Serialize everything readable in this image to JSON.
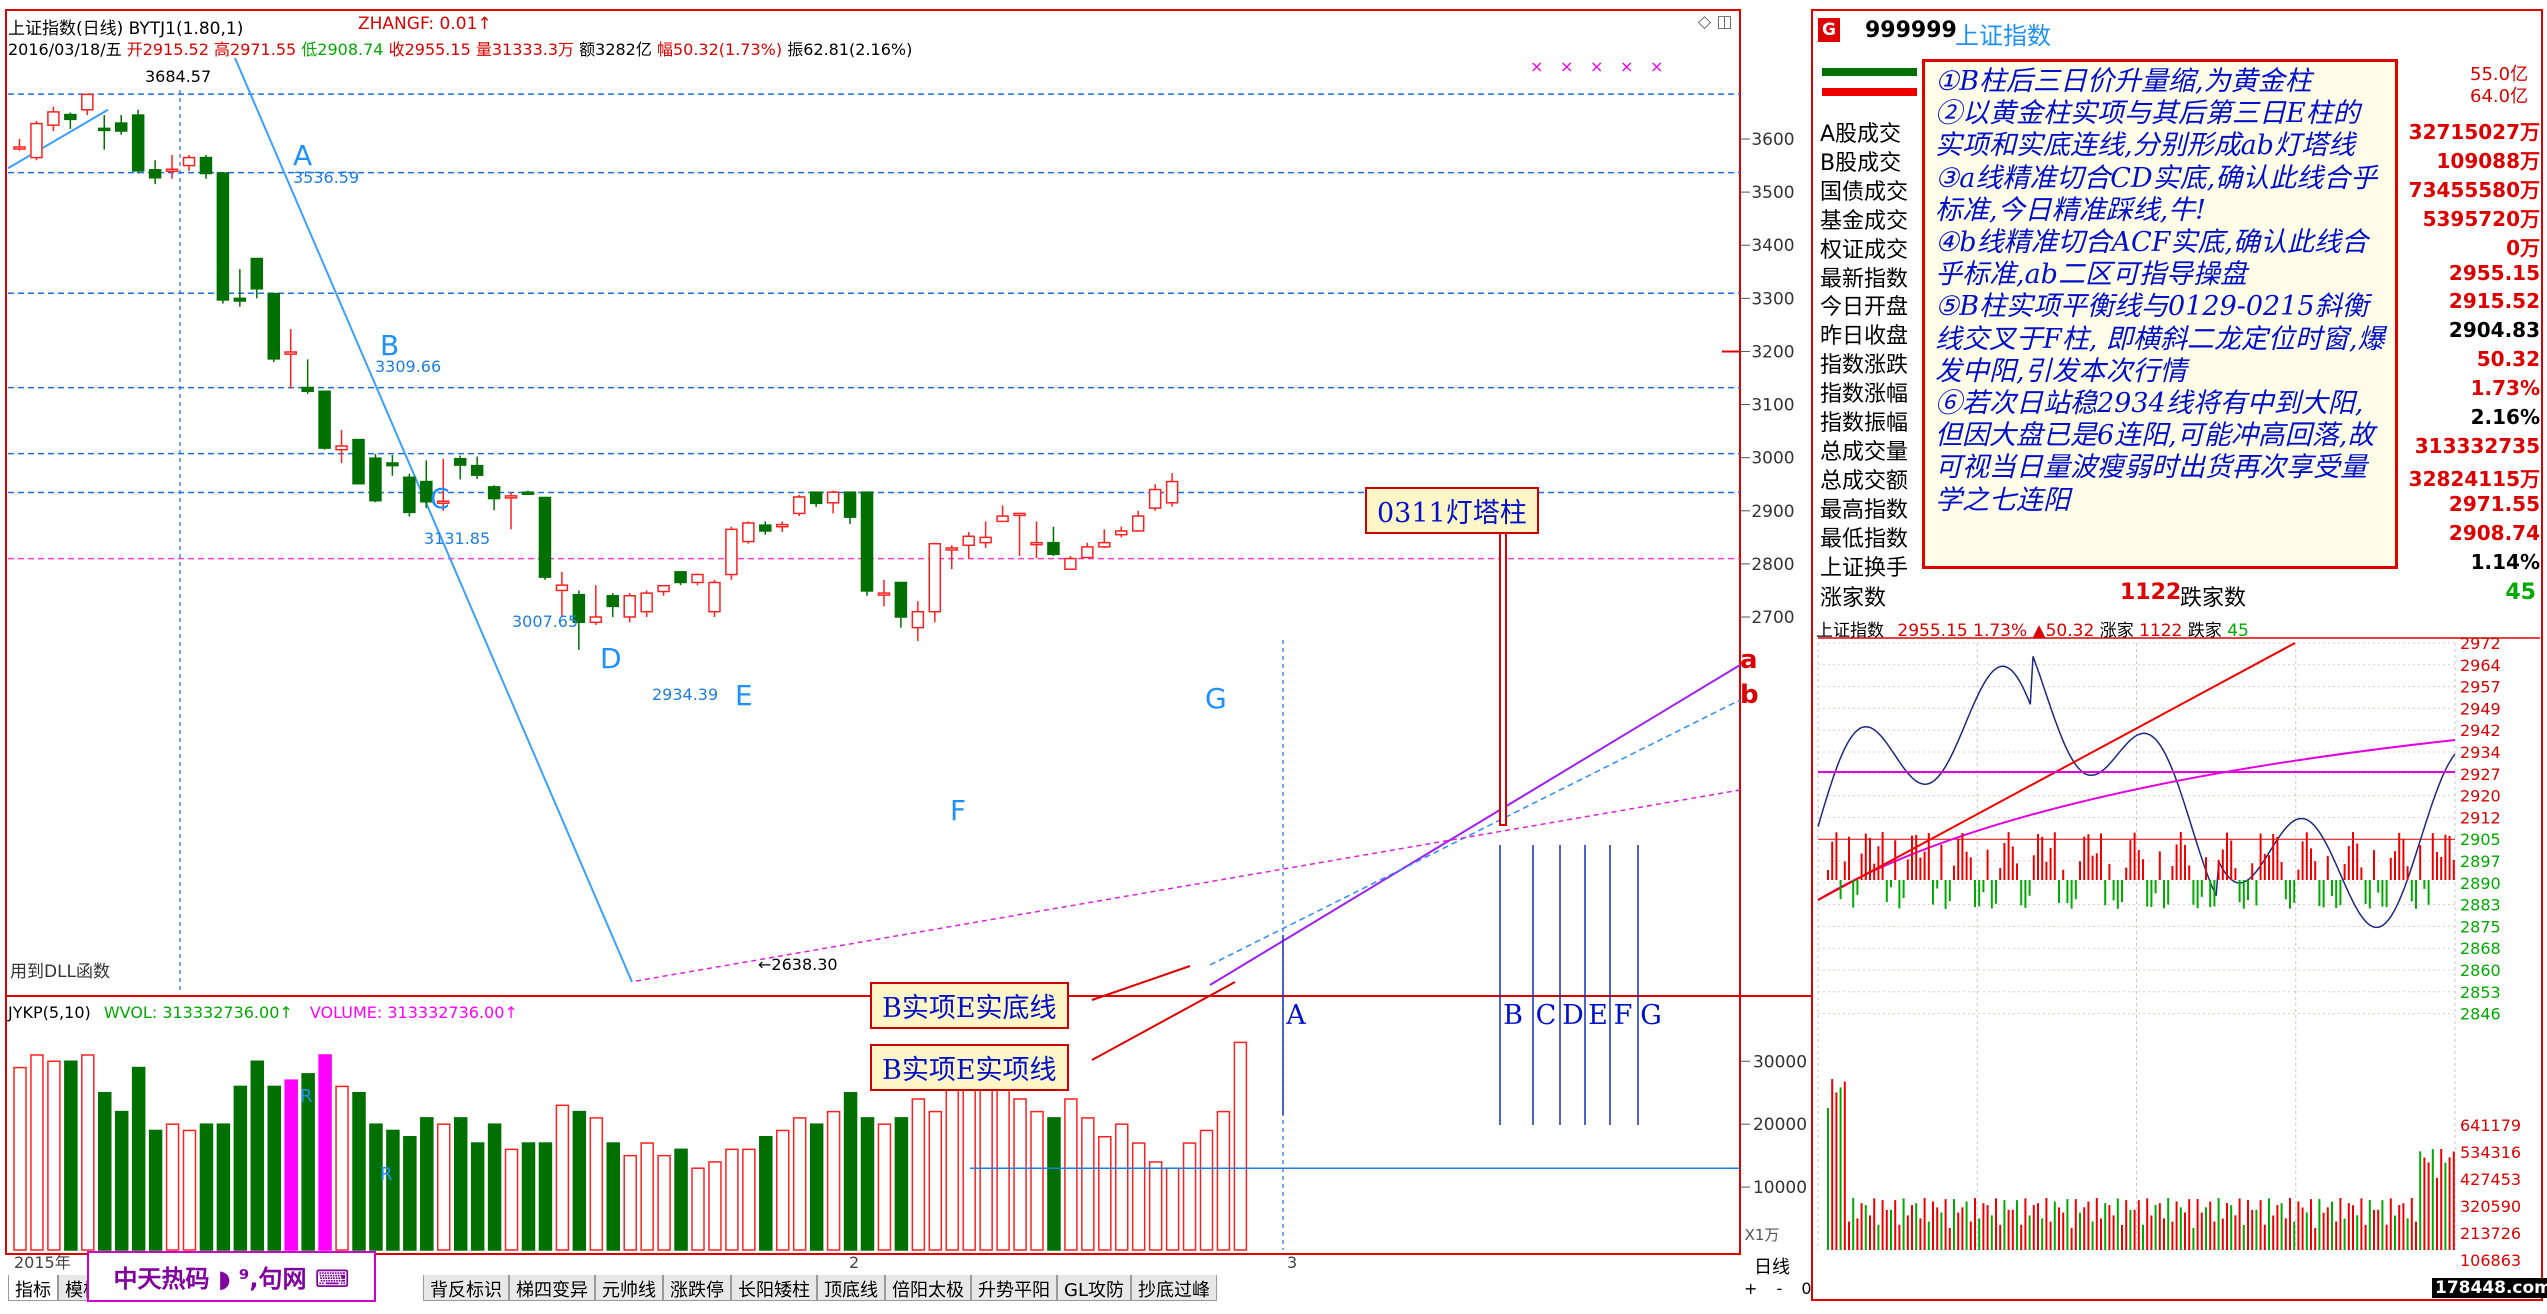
{
  "header": {
    "title": "上证指数(日线) BYTJ1(1.80,1)",
    "indicator": "ZHANGF: 0.01↑",
    "date": "2016/03/18/五",
    "open_label": "开",
    "open": "2915.52",
    "high_label": "高",
    "high": "2971.55",
    "low_label": "低",
    "low": "2908.74",
    "close_label": "收",
    "close": "2955.15",
    "vol_label": "量",
    "vol": "31333.3万",
    "amt_label": "额",
    "amt": "3282亿",
    "chg_label": "幅",
    "chg": "50.32(1.73%)",
    "amp_label": "振",
    "amp": "62.81(2.16%)"
  },
  "chart_data": {
    "type": "candlestick",
    "title": "上证指数(日线)",
    "ylim": [
      2600,
      3700
    ],
    "y_ticks": [
      2700,
      2800,
      2900,
      3000,
      3100,
      3200,
      3300,
      3400,
      3500,
      3600
    ],
    "candles": [
      [
        3582,
        3585,
        3600,
        3578
      ],
      [
        3565,
        3629,
        3634,
        3560
      ],
      [
        3626,
        3651,
        3661,
        3615
      ],
      [
        3646,
        3637,
        3650,
        3619
      ],
      [
        3655,
        3684,
        3685,
        3645
      ],
      [
        3620,
        3617,
        3645,
        3580
      ],
      [
        3630,
        3615,
        3645,
        3608
      ],
      [
        3645,
        3540,
        3655,
        3535
      ],
      [
        3542,
        3527,
        3560,
        3515
      ],
      [
        3540,
        3543,
        3570,
        3525
      ],
      [
        3550,
        3565,
        3570,
        3540
      ],
      [
        3565,
        3535,
        3570,
        3525
      ],
      [
        3536,
        3297,
        3536,
        3290
      ],
      [
        3300,
        3295,
        3355,
        3284
      ],
      [
        3375,
        3318,
        3375,
        3300
      ],
      [
        3309,
        3186,
        3309,
        3180
      ],
      [
        3195,
        3199,
        3242,
        3130
      ],
      [
        3132,
        3125,
        3185,
        3120
      ],
      [
        3125,
        3018,
        3125,
        3015
      ],
      [
        3015,
        3022,
        3052,
        2990
      ],
      [
        3034,
        2951,
        3035,
        2950
      ],
      [
        2999,
        2919,
        3007,
        2916
      ],
      [
        2990,
        2985,
        3005,
        2966
      ],
      [
        2963,
        2897,
        2970,
        2889
      ],
      [
        2955,
        2917,
        2995,
        2905
      ],
      [
        2917,
        2918,
        2998,
        2900
      ],
      [
        2998,
        2986,
        3004,
        2959
      ],
      [
        2985,
        2967,
        3002,
        2960
      ],
      [
        2945,
        2923,
        2948,
        2901
      ],
      [
        2925,
        2928,
        2934,
        2865
      ],
      [
        2935,
        2934,
        2938,
        2930
      ],
      [
        2925,
        2775,
        2925,
        2770
      ],
      [
        2750,
        2760,
        2785,
        2700
      ],
      [
        2742,
        2690,
        2750,
        2638
      ],
      [
        2690,
        2700,
        2760,
        2685
      ],
      [
        2740,
        2720,
        2745,
        2700
      ],
      [
        2700,
        2740,
        2745,
        2690
      ],
      [
        2710,
        2745,
        2750,
        2700
      ],
      [
        2748,
        2759,
        2760,
        2740
      ],
      [
        2785,
        2765,
        2785,
        2760
      ],
      [
        2765,
        2780,
        2782,
        2760
      ],
      [
        2710,
        2765,
        2770,
        2700
      ],
      [
        2780,
        2865,
        2870,
        2770
      ],
      [
        2842,
        2877,
        2880,
        2838
      ],
      [
        2873,
        2862,
        2880,
        2855
      ],
      [
        2870,
        2874,
        2880,
        2860
      ],
      [
        2895,
        2926,
        2930,
        2890
      ],
      [
        2935,
        2914,
        2935,
        2907
      ],
      [
        2915,
        2935,
        2938,
        2895
      ],
      [
        2935,
        2888,
        2935,
        2875
      ],
      [
        2935,
        2749,
        2935,
        2740
      ],
      [
        2745,
        2745,
        2770,
        2720
      ],
      [
        2765,
        2700,
        2765,
        2680
      ],
      [
        2680,
        2710,
        2730,
        2655
      ],
      [
        2710,
        2838,
        2840,
        2690
      ],
      [
        2830,
        2830,
        2835,
        2790
      ],
      [
        2835,
        2852,
        2860,
        2810
      ],
      [
        2840,
        2850,
        2880,
        2830
      ],
      [
        2880,
        2890,
        2910,
        2880
      ],
      [
        2893,
        2895,
        2895,
        2815
      ],
      [
        2840,
        2840,
        2880,
        2810
      ],
      [
        2840,
        2818,
        2870,
        2815
      ],
      [
        2790,
        2810,
        2815,
        2790
      ],
      [
        2812,
        2832,
        2840,
        2812
      ],
      [
        2832,
        2840,
        2865,
        2830
      ],
      [
        2855,
        2862,
        2870,
        2850
      ],
      [
        2862,
        2890,
        2900,
        2860
      ],
      [
        2905,
        2940,
        2950,
        2900
      ],
      [
        2915,
        2955,
        2971,
        2908
      ]
    ],
    "volume": [
      29000,
      31000,
      30000,
      30000,
      31000,
      25000,
      22000,
      29000,
      19000,
      20000,
      19000,
      20000,
      20000,
      26000,
      30000,
      26000,
      27000,
      28000,
      31000,
      26000,
      25000,
      20000,
      19000,
      18000,
      21000,
      20000,
      21000,
      17000,
      20000,
      16000,
      17000,
      17000,
      23000,
      22000,
      21000,
      17000,
      15000,
      17000,
      15000,
      16000,
      13000,
      14000,
      16000,
      16000,
      18000,
      19000,
      21000,
      20000,
      22000,
      25000,
      21000,
      20000,
      21000,
      24000,
      22000,
      27000,
      28000,
      28000,
      32000,
      24000,
      22000,
      21000,
      24000,
      21000,
      18000,
      20000,
      17000,
      14000,
      13000,
      17000,
      19000,
      22000,
      33000
    ],
    "vol_ylim": [
      0,
      35000
    ],
    "vol_ticks": [
      10000,
      20000,
      30000
    ],
    "volume_header": {
      "name": "JYKP(5,10)",
      "wvol": "WVOL: 313332736.00↑",
      "volume": "VOLUME: 313332736.00↑"
    },
    "price_labels": [
      "3684.57",
      "3536.59",
      "3309.66",
      "3131.85",
      "3007.65",
      "2934.39",
      "←2638.30"
    ],
    "point_labels": [
      "A",
      "B",
      "C",
      "D",
      "E",
      "F",
      "G"
    ],
    "line_labels": [
      "a",
      "b"
    ],
    "volume_arrow_labels": [
      "A",
      "B",
      "C",
      "D",
      "E",
      "F",
      "G"
    ],
    "volume_marks": [
      "R",
      "R"
    ],
    "month_labels": [
      "2015年",
      "2",
      "3"
    ],
    "axis_unit": "X1万",
    "dll_label": "用到DLL函数",
    "period": "日线"
  },
  "annotations": {
    "tower": "0311灯塔柱",
    "line1": "B实项E实底线",
    "line2": "B实项E实项线",
    "note": [
      "①B柱后三日价升量缩,为黄金柱",
      "②以黄金柱实项与其后第三日E柱的实项和实底连线,分别形成ab灯塔线",
      "③a线精准切合CD实底,确认此线合乎标准,今日精准踩线,牛!",
      "④b线精准切合ACF实底,确认此线合乎标准,ab二区可指导操盘",
      "⑤B柱实项平衡线与0129-0215斜衡线交叉于F柱, 即横斜二龙定位时窗,爆发中阳,引发本次行情",
      "⑥若次日站稳2934线将有中到大阳,但因大盘已是6连阳,可能冲高回落,故可视当日量波瘦弱时出货再次享受量学之七连阳"
    ]
  },
  "right_panel": {
    "code": "999999",
    "name": "上证指数",
    "g_badge": "G",
    "top_values": [
      "55.0亿",
      "64.0亿"
    ],
    "rows": [
      {
        "label": "A股成交",
        "value": "32715027万"
      },
      {
        "label": "B股成交",
        "value": "109088万"
      },
      {
        "label": "国债成交",
        "value": "73455580万"
      },
      {
        "label": "基金成交",
        "value": "5395720万"
      },
      {
        "label": "权证成交",
        "value": "0万"
      },
      {
        "label": "最新指数",
        "value": "2955.15"
      },
      {
        "label": "今日开盘",
        "value": "2915.52"
      },
      {
        "label": "昨日收盘",
        "value": "2904.83"
      },
      {
        "label": "指数涨跌",
        "value": "50.32"
      },
      {
        "label": "指数涨幅",
        "value": "1.73%"
      },
      {
        "label": "指数振幅",
        "value": "2.16%"
      },
      {
        "label": "总成交量",
        "value": "313332735"
      },
      {
        "label": "总成交额",
        "value": "32824115万"
      },
      {
        "label": "最高指数",
        "value": "2971.55"
      },
      {
        "label": "最低指数",
        "value": "2908.74"
      },
      {
        "label": "上证换手",
        "value": "1.14%"
      }
    ],
    "rise_label": "涨家数",
    "rise": "1122",
    "fall_label": "跌家数",
    "fall": "45",
    "mini_header": {
      "name": "上证指数",
      "price": "2955.15",
      "pct": "1.73%",
      "chg": "▲50.32",
      "rise_label": "涨家",
      "rise": "1122",
      "fall_label": "跌家",
      "fall": "45"
    },
    "mini_ticks": [
      "2972",
      "2964",
      "2957",
      "2949",
      "2942",
      "2934",
      "2927",
      "2920",
      "2912",
      "2905",
      "2897",
      "2890",
      "2883",
      "2875",
      "2868",
      "2860",
      "2853",
      "2846"
    ],
    "mini_vol_ticks": [
      "641179",
      "534316",
      "427453",
      "320590",
      "213726",
      "106863"
    ],
    "watermark": "178448.com"
  },
  "tabs": [
    "指标",
    "模板",
    "背反标识",
    "梯四变异",
    "元帅线",
    "涨跌停",
    "长阳矮柱",
    "顶底线",
    "倍阳太极",
    "升势平阳",
    "GL攻防",
    "抄底过峰"
  ],
  "logo": "中天热码 ◗ ⁹,句网 ⌨",
  "side_top": [
    "◇",
    "◫"
  ],
  "zoom": [
    "+",
    "-",
    "0"
  ],
  "colors": {
    "up": "#ff2020",
    "down": "#007000",
    "grid": "#1e6edc",
    "note_text": "#0010c8",
    "pink": "#ff00ff"
  }
}
